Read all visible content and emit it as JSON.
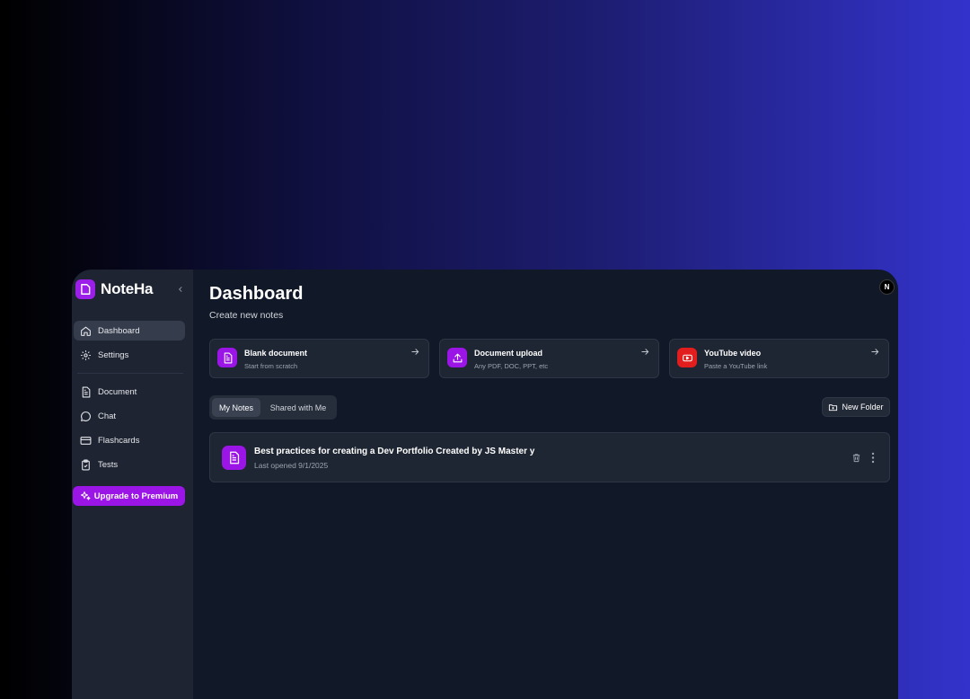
{
  "app": {
    "name": "NoteHa",
    "avatar_initial": "N"
  },
  "sidebar": {
    "items": [
      {
        "label": "Dashboard",
        "icon": "home-icon",
        "active": true
      },
      {
        "label": "Settings",
        "icon": "gear-icon",
        "active": false
      },
      {
        "label": "Document",
        "icon": "document-icon",
        "active": false
      },
      {
        "label": "Chat",
        "icon": "chat-icon",
        "active": false
      },
      {
        "label": "Flashcards",
        "icon": "card-icon",
        "active": false
      },
      {
        "label": "Tests",
        "icon": "clipboard-check-icon",
        "active": false
      }
    ],
    "upgrade_label": "Upgrade to Premium"
  },
  "header": {
    "title": "Dashboard",
    "subtitle": "Create new notes"
  },
  "create_cards": [
    {
      "title": "Blank document",
      "description": "Start from scratch",
      "icon": "document-icon",
      "color": "#9b16e6"
    },
    {
      "title": "Document upload",
      "description": "Any PDF, DOC, PPT, etc",
      "icon": "upload-icon",
      "color": "#9b16e6"
    },
    {
      "title": "YouTube video",
      "description": "Paste a YouTube link",
      "icon": "youtube-icon",
      "color": "#e11d1d"
    }
  ],
  "tabs": [
    {
      "label": "My Notes",
      "active": true
    },
    {
      "label": "Shared with Me",
      "active": false
    }
  ],
  "new_folder_label": "New Folder",
  "notes": [
    {
      "title": "Best practices for creating a Dev Portfolio Created by JS Master y",
      "meta": "Last opened 9/1/2025"
    }
  ],
  "colors": {
    "accent": "#9b16e6",
    "youtube": "#e11d1d",
    "panel": "#111827",
    "sidebar": "#1e2432"
  }
}
